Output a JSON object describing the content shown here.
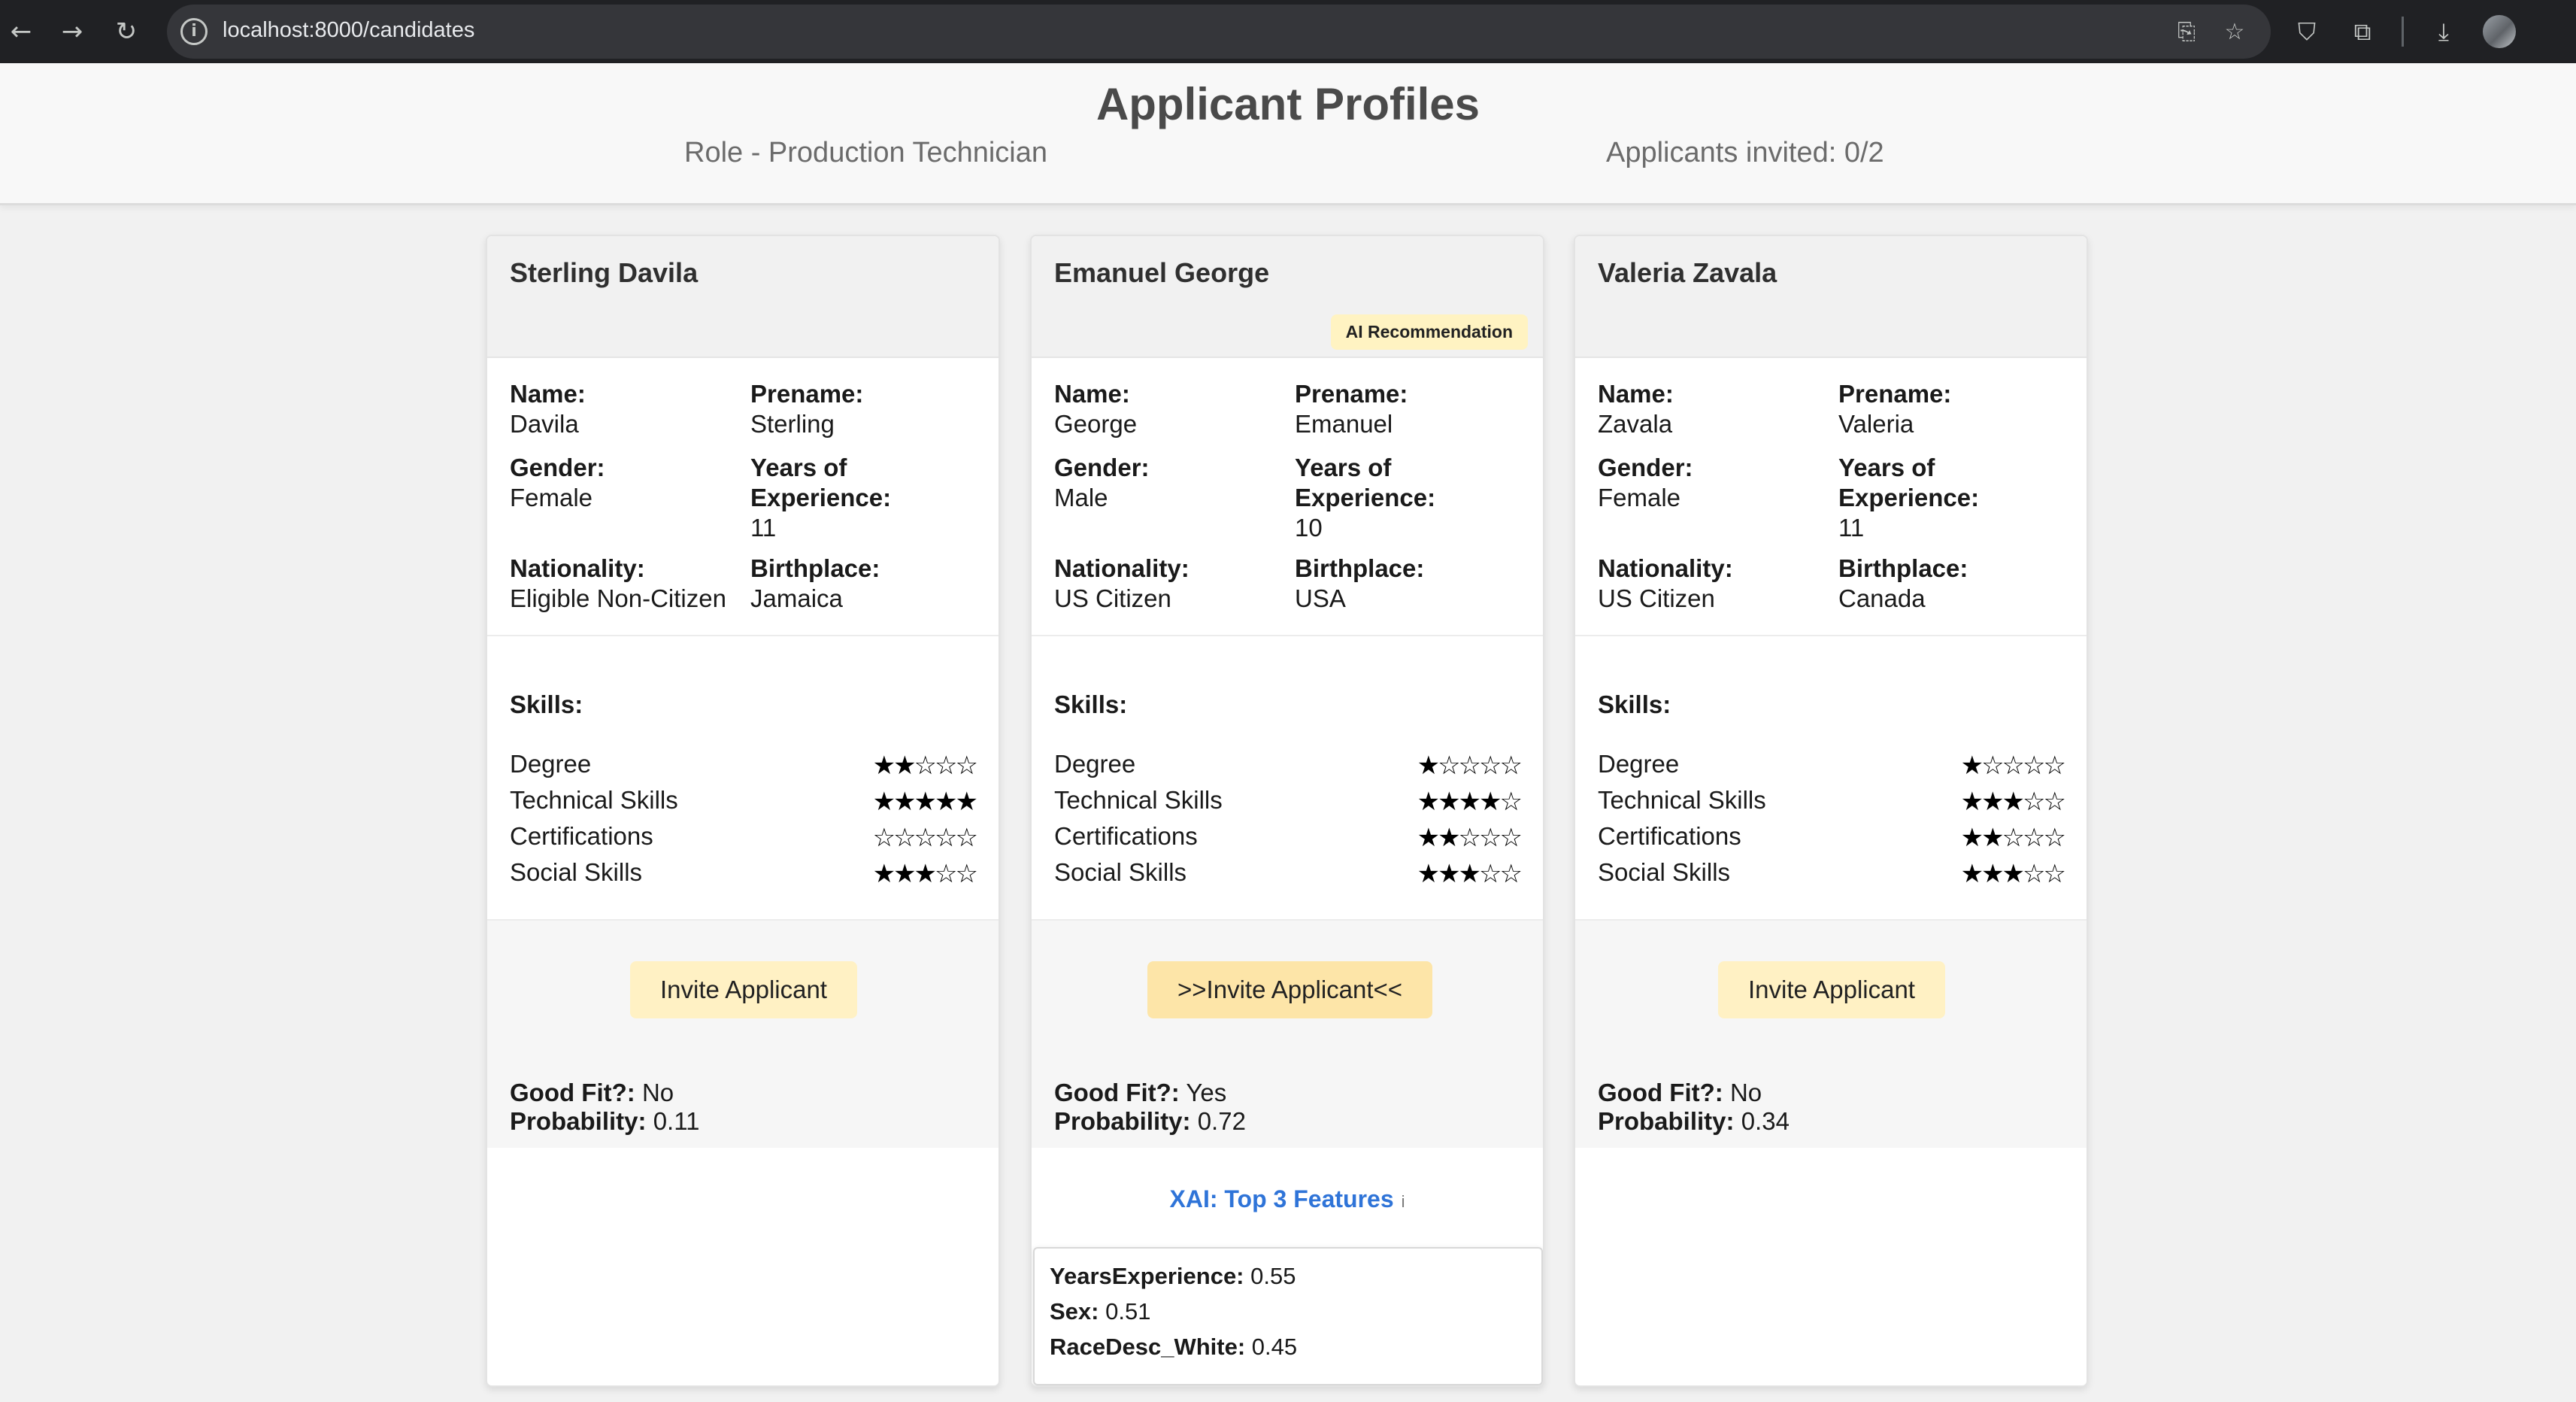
{
  "browser": {
    "url": "localhost:8000/candidates"
  },
  "header": {
    "title": "Applicant Profiles",
    "role": "Role - Production Technician",
    "invited": "Applicants invited: 0/2"
  },
  "labels": {
    "name": "Name:",
    "prename": "Prename:",
    "gender": "Gender:",
    "years": "Years of Experience:",
    "nationality": "Nationality:",
    "birthplace": "Birthplace:",
    "skills": "Skills:",
    "good_fit": "Good Fit?:",
    "probability": "Probability:",
    "degree": "Degree",
    "technical": "Technical Skills",
    "certifications": "Certifications",
    "social": "Social Skills"
  },
  "candidates": [
    {
      "full_name": "Sterling Davila",
      "name": "Davila",
      "prename": "Sterling",
      "gender": "Female",
      "years": "11",
      "nationality": "Eligible Non-Citizen",
      "birthplace": "Jamaica",
      "skills": {
        "degree": 2,
        "technical": 5,
        "certifications": 0,
        "social": 3
      },
      "invite_label": "Invite Applicant",
      "good_fit": "No",
      "probability": "0.11"
    },
    {
      "full_name": "Emanuel George",
      "badge": "AI Recommendation",
      "name": "George",
      "prename": "Emanuel",
      "gender": "Male",
      "years": "10",
      "nationality": "US Citizen",
      "birthplace": "USA",
      "skills": {
        "degree": 1,
        "technical": 4,
        "certifications": 2,
        "social": 3
      },
      "invite_label": ">>Invite Applicant<<",
      "good_fit": "Yes",
      "probability": "0.72",
      "xai": {
        "link": "XAI: Top 3 Features",
        "info_icon": "i",
        "features": [
          {
            "name": "YearsExperience:",
            "value": "0.55"
          },
          {
            "name": "Sex:",
            "value": "0.51"
          },
          {
            "name": "RaceDesc_White:",
            "value": "0.45"
          }
        ]
      }
    },
    {
      "full_name": "Valeria Zavala",
      "name": "Zavala",
      "prename": "Valeria",
      "gender": "Female",
      "years": "11",
      "nationality": "US Citizen",
      "birthplace": "Canada",
      "skills": {
        "degree": 1,
        "technical": 3,
        "certifications": 2,
        "social": 3
      },
      "invite_label": "Invite Applicant",
      "good_fit": "No",
      "probability": "0.34"
    }
  ],
  "star_max": 5
}
